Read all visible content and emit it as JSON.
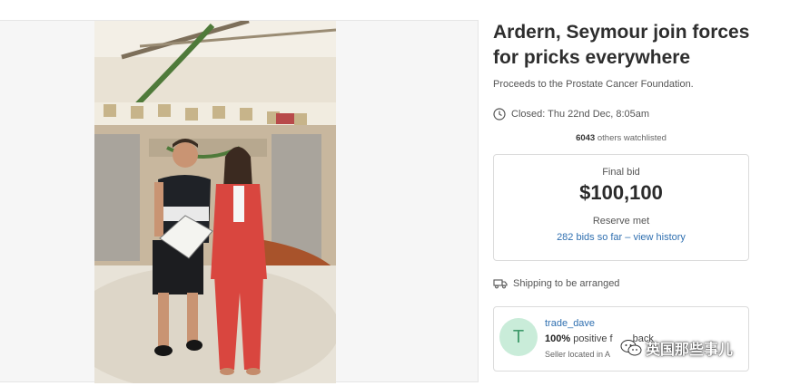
{
  "listing": {
    "title": "Ardern, Seymour join forces for pricks everywhere",
    "subtitle": "Proceeds to the Prostate Cancer Foundation.",
    "closed": "Closed: Thu 22nd Dec, 8:05am",
    "watch_count": "6043",
    "watch_text": " others watchlisted"
  },
  "bid": {
    "label": "Final bid",
    "amount": "$100,100",
    "reserve": "Reserve met",
    "history_link": "282 bids so far – view history"
  },
  "shipping": {
    "text": "Shipping to be arranged"
  },
  "seller": {
    "avatar_letter": "T",
    "name": "trade_dave",
    "feedback_pct": "100%",
    "feedback_text": " positive f",
    "feedback_tail": "back",
    "location": "Seller located in A"
  },
  "watermark": {
    "text": "英国那些事儿"
  },
  "colors": {
    "link": "#2f6fb0",
    "avatar_bg": "#c9ecd9",
    "avatar_fg": "#3f9a6b",
    "suit": "#d9463f"
  },
  "icons": {
    "closed": "clock-icon",
    "shipping": "truck-icon",
    "watermark": "wechat-icon"
  }
}
